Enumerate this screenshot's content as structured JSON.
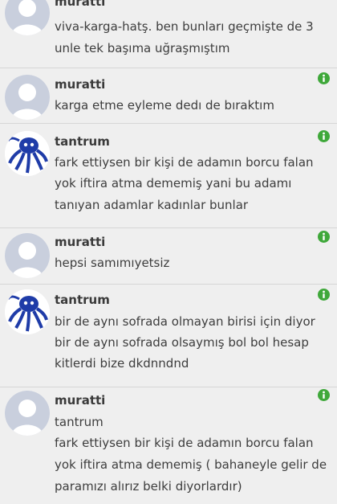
{
  "posts": [
    {
      "user": "muratti",
      "lines": [
        "viva-karga-hatş. ben bunları geçmişte de 3",
        "unle tek başıma uğraşmıştım"
      ]
    },
    {
      "user": "muratti",
      "lines": [
        "karga etme eyleme dedı de bıraktım"
      ]
    },
    {
      "user": "tantrum",
      "lines": [
        "fark ettiysen bir kişi de adamın borcu falan",
        "yok iftira atma dememiş yani bu adamı",
        "tanıyan adamlar kadınlar bunlar"
      ]
    },
    {
      "user": "muratti",
      "lines": [
        "hepsi samımıyetsiz"
      ]
    },
    {
      "user": "tantrum",
      "lines": [
        "bir de aynı sofrada olmayan birisi için diyor",
        "bir de aynı sofrada olsaymış bol bol hesap",
        "kitlerdi bize dkdnndnd"
      ]
    },
    {
      "user": "muratti",
      "lines": [
        "tantrum",
        "fark ettiysen bir kişi de adamın borcu falan",
        "yok iftira atma dememiş ( bahaneyle gelir de",
        "paramızı alırız belki diyorlardır)"
      ]
    }
  ],
  "icons": {
    "default_avatar": "default-avatar-icon",
    "custom_avatar": "octopus-avatar-icon",
    "info": "info-icon"
  },
  "colors": {
    "info_green": "#3fa83a",
    "avatar_bg": "#c9cfdd",
    "avatar_figure": "#ffffff",
    "octopus_blue": "#1f3ca8"
  }
}
